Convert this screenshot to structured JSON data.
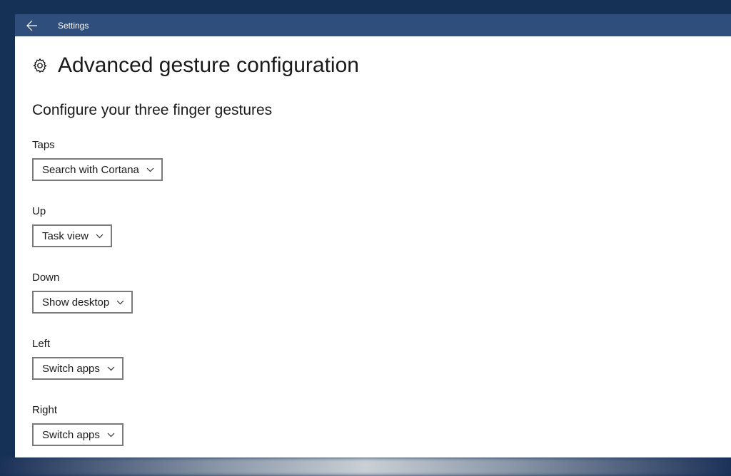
{
  "titlebar": {
    "app_name": "Settings"
  },
  "page": {
    "title": "Advanced gesture configuration",
    "section_heading": "Configure your three finger gestures"
  },
  "settings": {
    "taps": {
      "label": "Taps",
      "value": "Search with Cortana"
    },
    "up": {
      "label": "Up",
      "value": "Task view"
    },
    "down": {
      "label": "Down",
      "value": "Show desktop"
    },
    "left": {
      "label": "Left",
      "value": "Switch apps"
    },
    "right": {
      "label": "Right",
      "value": "Switch apps"
    }
  }
}
